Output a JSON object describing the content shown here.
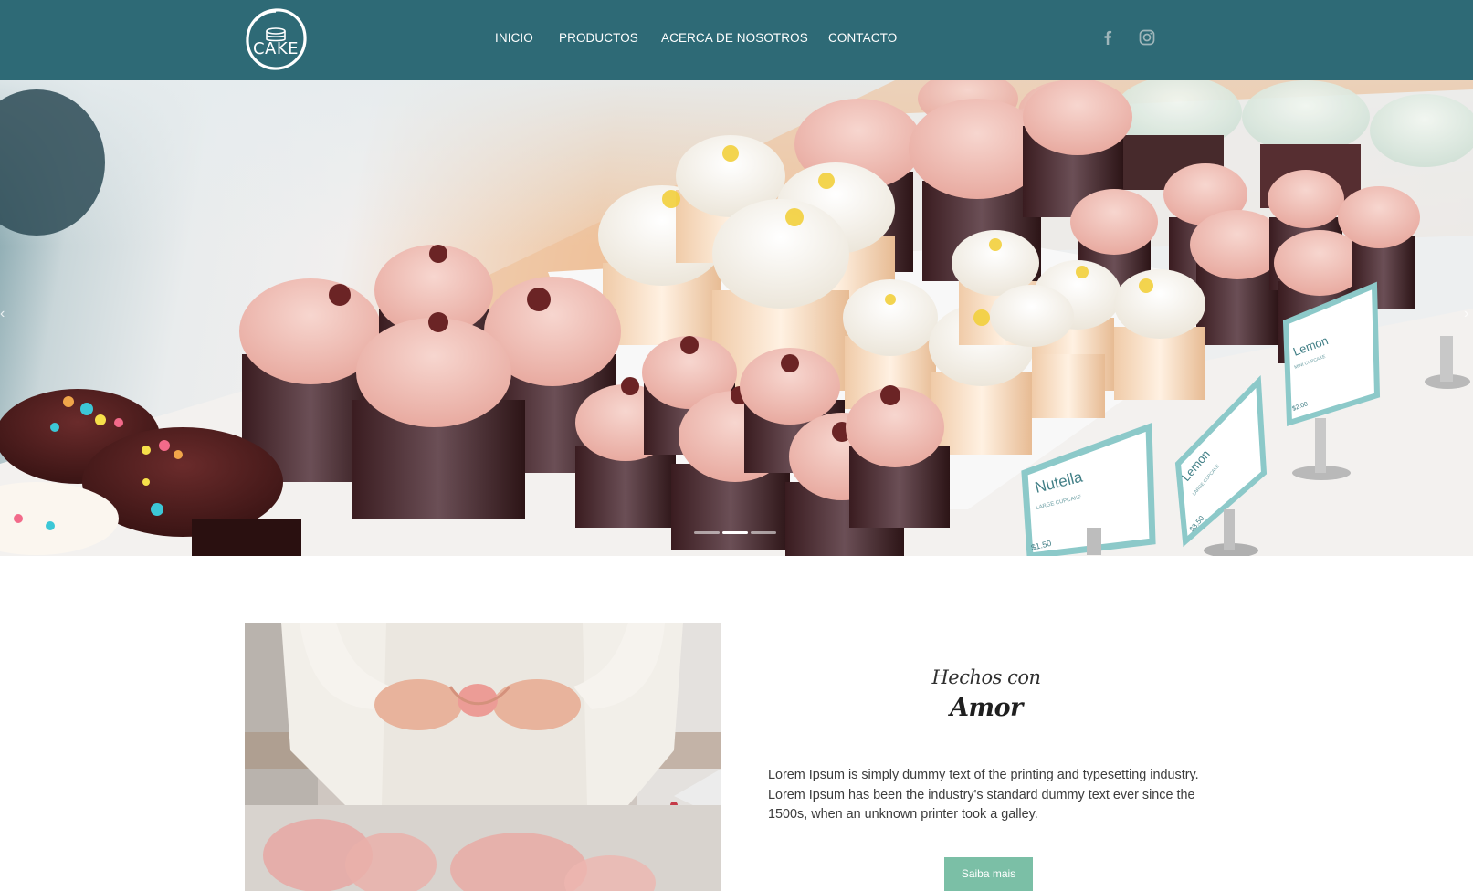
{
  "brand": {
    "logo_text": "CAKE",
    "primary_color": "#2e6a76",
    "button_color": "#7bbfa6"
  },
  "nav": {
    "items": [
      {
        "label": "INICIO"
      },
      {
        "label": "PRODUCTOS"
      },
      {
        "label": "ACERCA DE NOSOTROS"
      },
      {
        "label": "CONTACTO"
      }
    ]
  },
  "social": {
    "icons": [
      "facebook-icon",
      "instagram-icon"
    ]
  },
  "hero": {
    "slides_total": 3,
    "active_slide": 2,
    "signs": [
      {
        "name": "Nutella",
        "sub": "LARGE CUPCAKE",
        "price": "$1.50"
      },
      {
        "name": "Lemon",
        "sub": "LARGE CUPCAKE",
        "price": "$3.50"
      },
      {
        "name": "Lemon",
        "sub": "MINI CUPCAKE",
        "price": "$2.00"
      }
    ]
  },
  "about": {
    "title_small": "Hechos con",
    "title_big": "Amor",
    "text": "Lorem Ipsum is simply dummy text of the printing and typesetting industry. Lorem Ipsum has been the industry's standard dummy text ever since the 1500s, when an unknown printer took a galley.",
    "button_label": "Saiba mais"
  }
}
